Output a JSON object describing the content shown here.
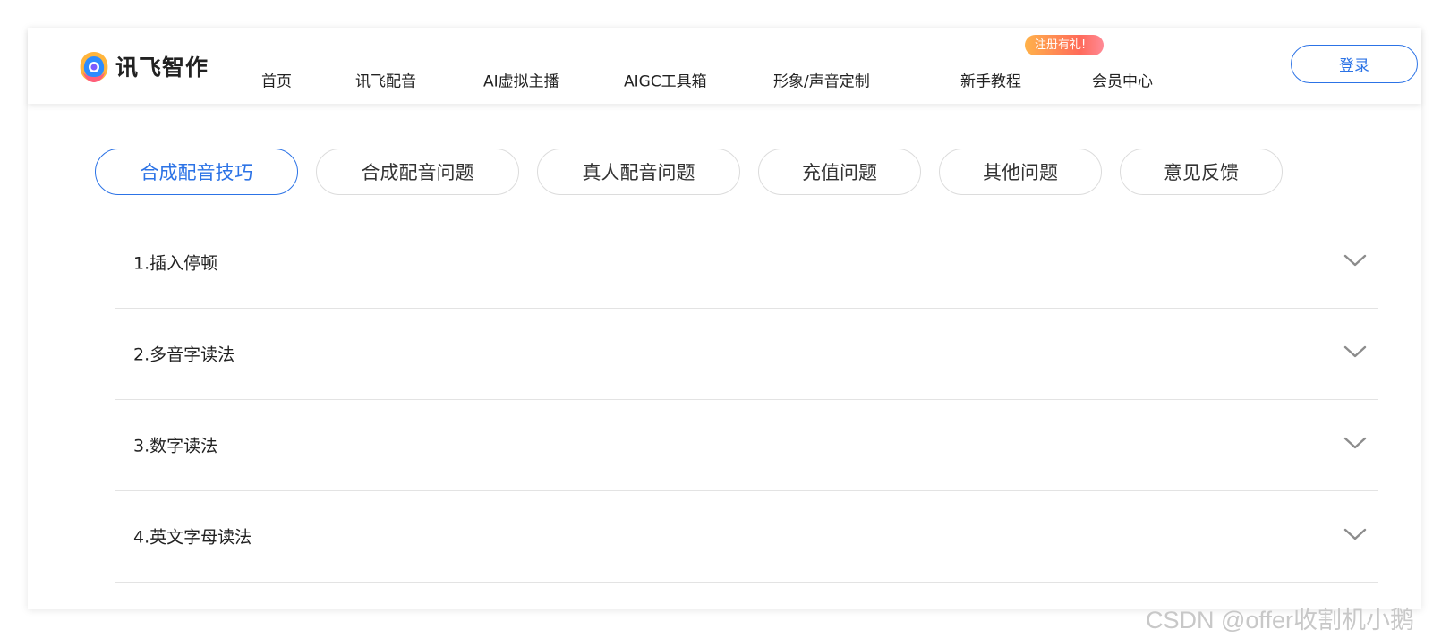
{
  "brand": {
    "name": "讯飞智作"
  },
  "nav": [
    {
      "label": "首页"
    },
    {
      "label": "讯飞配音"
    },
    {
      "label": "AI虚拟主播"
    },
    {
      "label": "AIGC工具箱"
    },
    {
      "label": "形象/声音定制"
    },
    {
      "label": "新手教程"
    },
    {
      "label": "会员中心"
    }
  ],
  "promo_badge": "注册有礼!",
  "login_label": "登录",
  "tabs": [
    {
      "label": "合成配音技巧",
      "active": true
    },
    {
      "label": "合成配音问题",
      "active": false
    },
    {
      "label": "真人配音问题",
      "active": false
    },
    {
      "label": "充值问题",
      "active": false
    },
    {
      "label": "其他问题",
      "active": false
    },
    {
      "label": "意见反馈",
      "active": false
    }
  ],
  "faq": [
    {
      "question": "1.插入停顿",
      "icon": "chevron-down-icon"
    },
    {
      "question": "2.多音字读法",
      "icon": "chevron-down-icon"
    },
    {
      "question": "3.数字读法",
      "icon": "chevron-down-icon"
    },
    {
      "question": "4.英文字母读法",
      "icon": "chevron-down-icon"
    }
  ],
  "watermark": "CSDN @offer收割机小鹅",
  "colors": {
    "accent": "#2c73e6",
    "badge_start": "#ffb24a",
    "badge_end": "#ff6a5a"
  }
}
